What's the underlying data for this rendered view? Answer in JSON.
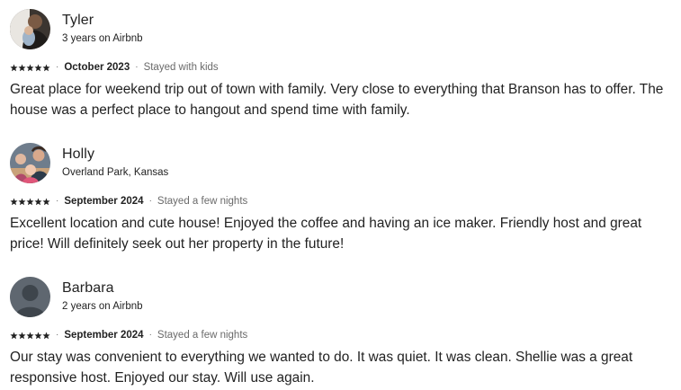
{
  "reviews": [
    {
      "name": "Tyler",
      "meta": "3 years on Airbnb",
      "rating": 5,
      "date": "October 2023",
      "stay": "Stayed with kids",
      "text": "Great place for weekend trip out of town with family. Very close to everything that Branson has to offer. The house was a perfect place to hangout and spend time with family.",
      "avatar": "photo-avatar"
    },
    {
      "name": "Holly",
      "meta": "Overland Park, Kansas",
      "rating": 5,
      "date": "September 2024",
      "stay": "Stayed a few nights",
      "text": "Excellent location and cute house! Enjoyed the coffee and having an ice maker. Friendly host and great price! Will definitely seek out her property in the future!",
      "avatar": "photo-avatar"
    },
    {
      "name": "Barbara",
      "meta": "2 years on Airbnb",
      "rating": 5,
      "date": "September 2024",
      "stay": "Stayed a few nights",
      "text": "Our stay was convenient to everything we wanted to do. It was quiet. It was clean. Shellie was a great responsive host. Enjoyed our stay. Will use again.",
      "avatar": "default-user-avatar"
    }
  ],
  "colors": {
    "text": "#222222",
    "muted": "#6a6a6a",
    "default_avatar_bg": "#5f6770",
    "default_avatar_fg": "#3e454c"
  }
}
